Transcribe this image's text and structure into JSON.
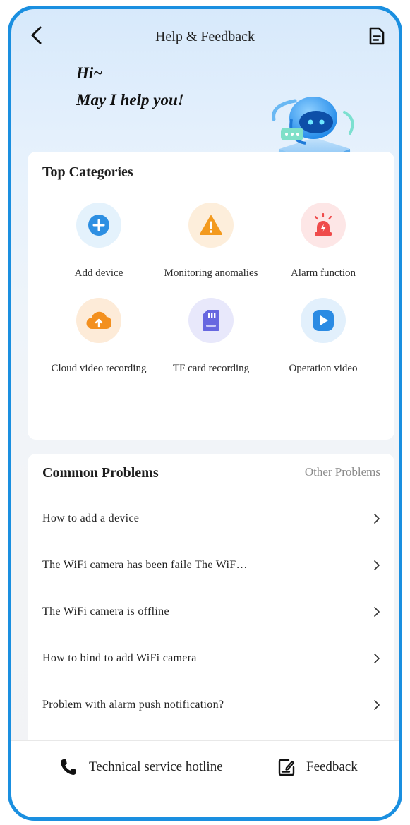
{
  "header": {
    "title": "Help & Feedback",
    "back_icon": "chevron-left-icon",
    "action_icon": "document-icon"
  },
  "greeting": {
    "line1": "Hi~",
    "line2": "May I help you!"
  },
  "top_categories": {
    "title": "Top Categories",
    "items": [
      {
        "label": "Add device",
        "icon": "plus-circle-icon",
        "bg": "#e4f2fc",
        "color": "#2d8fe2"
      },
      {
        "label": "Monitoring anomalies",
        "icon": "warning-icon",
        "bg": "#fdeedb",
        "color": "#f39a1e"
      },
      {
        "label": "Alarm function",
        "icon": "siren-icon",
        "bg": "#fde6e6",
        "color": "#ef4b4b"
      },
      {
        "label": "Cloud video recording",
        "icon": "cloud-upload-icon",
        "bg": "#fdebd8",
        "color": "#f3901f"
      },
      {
        "label": "TF card recording",
        "icon": "sd-card-icon",
        "bg": "#e8e8fb",
        "color": "#6767e0"
      },
      {
        "label": "Operation video",
        "icon": "play-icon",
        "bg": "#e2f0fc",
        "color": "#2b8be3"
      }
    ]
  },
  "common_problems": {
    "title": "Common Problems",
    "other_link": "Other Problems",
    "items": [
      "How to add a device",
      "The WiFi camera has been faile The WiF…",
      "The WiFi camera is offline",
      "How to bind to add WiFi camera",
      "Problem with alarm push notification?"
    ]
  },
  "bottom_bar": {
    "hotline_label": "Technical service hotline",
    "hotline_icon": "phone-icon",
    "feedback_label": "Feedback",
    "feedback_icon": "edit-note-icon"
  },
  "colors": {
    "frame_border": "#1a8fe0",
    "accent": "#2d8fe2"
  }
}
